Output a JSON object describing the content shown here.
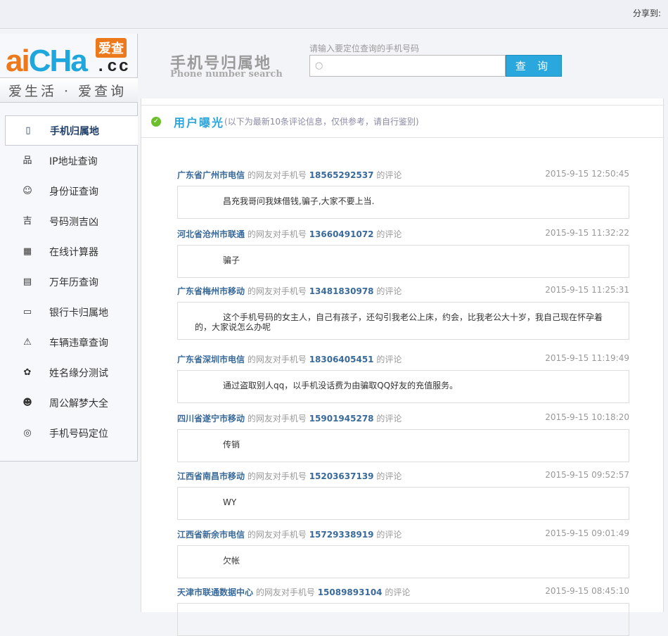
{
  "topbar": {
    "share": "分享到:"
  },
  "logo": {
    "main1": "ai",
    "main2": "CHa",
    "tag": "爱查",
    "domain": ".cc",
    "slogan": "爱生活 · 爱查询"
  },
  "menu": [
    {
      "label": "手机归属地",
      "icon": "phone-icon",
      "glyph": "▯"
    },
    {
      "label": "IP地址查询",
      "icon": "network-icon",
      "glyph": "品"
    },
    {
      "label": "身份证查询",
      "icon": "user-icon",
      "glyph": "☺"
    },
    {
      "label": "号码测吉凶",
      "icon": "lucky-icon",
      "glyph": "吉"
    },
    {
      "label": "在线计算器",
      "icon": "calculator-icon",
      "glyph": "▦"
    },
    {
      "label": "万年历查询",
      "icon": "calendar-icon",
      "glyph": "▤"
    },
    {
      "label": "银行卡归属地",
      "icon": "bank-card-icon",
      "glyph": "▭"
    },
    {
      "label": "车辆违章查询",
      "icon": "warning-icon",
      "glyph": "⚠"
    },
    {
      "label": "姓名缘分测试",
      "icon": "flower-icon",
      "glyph": "✿"
    },
    {
      "label": "周公解梦大全",
      "icon": "dream-icon",
      "glyph": "☻"
    },
    {
      "label": "手机号码定位",
      "icon": "locate-icon",
      "glyph": "◎"
    }
  ],
  "header": {
    "title": "手机号归属地",
    "subtitle": "Phone number search",
    "search_label": "请输入要定位查询的手机号码",
    "search_value": "",
    "search_button": "查 询"
  },
  "section": {
    "title": "用户曝光",
    "note": "(以下为最新10条评论信息，仅供参考，请自行鉴别)"
  },
  "comment_mid": "的网友对手机号",
  "comment_end": "的评论",
  "comments": [
    {
      "from": "广东省广州市电信",
      "number": "18565292537",
      "time": "2015-9-15 12:50:45",
      "text": "昌充我哥问我妹借钱,骗子,大家不要上当."
    },
    {
      "from": "河北省沧州市联通",
      "number": "13660491072",
      "time": "2015-9-15 11:32:22",
      "text": "骗子"
    },
    {
      "from": "广东省梅州市移动",
      "number": "13481830978",
      "time": "2015-9-15 11:25:31",
      "text": "这个手机号码的女主人，自己有孩子，还勾引我老公上床，约会，比我老公大十岁，我自己现在怀孕着的，大家说怎么办呢"
    },
    {
      "from": "广东省深圳市电信",
      "number": "18306405451",
      "time": "2015-9-15 11:19:49",
      "text": "通过盗取别人qq，以手机没话费为由骗取QQ好友的充值服务。"
    },
    {
      "from": "四川省遂宁市移动",
      "number": "15901945278",
      "time": "2015-9-15 10:18:20",
      "text": "传销"
    },
    {
      "from": "江西省南昌市移动",
      "number": "15203637139",
      "time": "2015-9-15 09:52:57",
      "text": "WY"
    },
    {
      "from": "江西省新余市电信",
      "number": "15729338919",
      "time": "2015-9-15 09:01:49",
      "text": "欠帐"
    },
    {
      "from": "天津市联通数据中心",
      "number": "15089893104",
      "time": "2015-9-15 08:45:10",
      "text": ""
    }
  ]
}
